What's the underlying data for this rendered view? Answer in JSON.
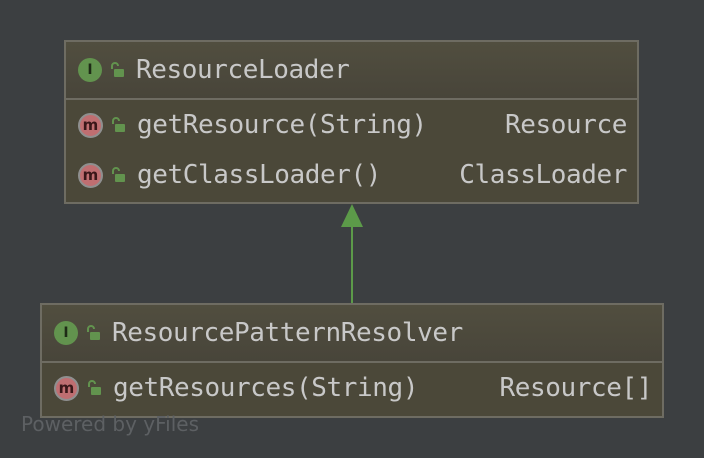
{
  "diagram": {
    "top_class": {
      "kind_icon": "interface-icon",
      "kind_letter": "I",
      "name": "ResourceLoader",
      "methods": [
        {
          "icon": "method-icon",
          "icon_letter": "m",
          "name": "getResource(String)",
          "return_type": "Resource"
        },
        {
          "icon": "method-icon",
          "icon_letter": "m",
          "name": "getClassLoader()",
          "return_type": "ClassLoader"
        }
      ]
    },
    "bottom_class": {
      "kind_icon": "interface-icon",
      "kind_letter": "I",
      "name": "ResourcePatternResolver",
      "methods": [
        {
          "icon": "method-icon",
          "icon_letter": "m",
          "name": "getResources(String)",
          "return_type": "Resource[]"
        }
      ]
    },
    "relation": {
      "type": "extends",
      "from": "ResourcePatternResolver",
      "to": "ResourceLoader"
    }
  },
  "watermark": "Powered by yFiles",
  "colors": {
    "background": "#3c3f41",
    "box_fill": "#4b4839",
    "box_border": "#6e6c62",
    "text": "#c8c8c8",
    "interface_icon": "#62934e",
    "method_icon": "#bf6e71",
    "public_lock": "#62934e",
    "arrow": "#5c9a49"
  }
}
